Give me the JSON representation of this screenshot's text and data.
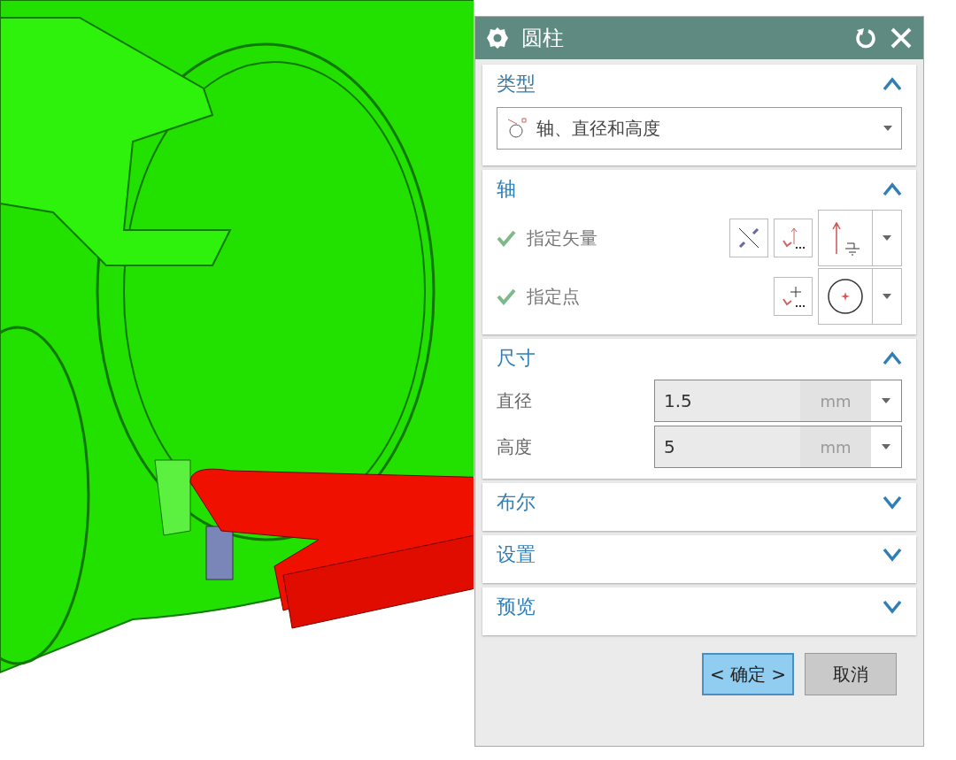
{
  "window": {
    "title": "圆柱"
  },
  "sections": [
    {
      "kind": "type",
      "title": "类型",
      "expanded": true,
      "dropdown": {
        "value": "轴、直径和高度"
      }
    },
    {
      "kind": "axis",
      "title": "轴",
      "expanded": true,
      "rows": [
        {
          "kind": "vector",
          "label": "指定矢量",
          "checked": true
        },
        {
          "kind": "point",
          "label": "指定点",
          "checked": true
        }
      ]
    },
    {
      "kind": "dims",
      "title": "尺寸",
      "expanded": true,
      "fields": [
        {
          "label": "直径",
          "value": "1.5",
          "unit": "mm"
        },
        {
          "label": "高度",
          "value": "5",
          "unit": "mm"
        }
      ]
    },
    {
      "title": "布尔",
      "expanded": false
    },
    {
      "title": "设置",
      "expanded": false
    },
    {
      "title": "预览",
      "expanded": false
    }
  ],
  "buttons": [
    {
      "kind": "default",
      "label": "< 确定 >"
    },
    {
      "kind": "normal",
      "label": "取消"
    }
  ]
}
